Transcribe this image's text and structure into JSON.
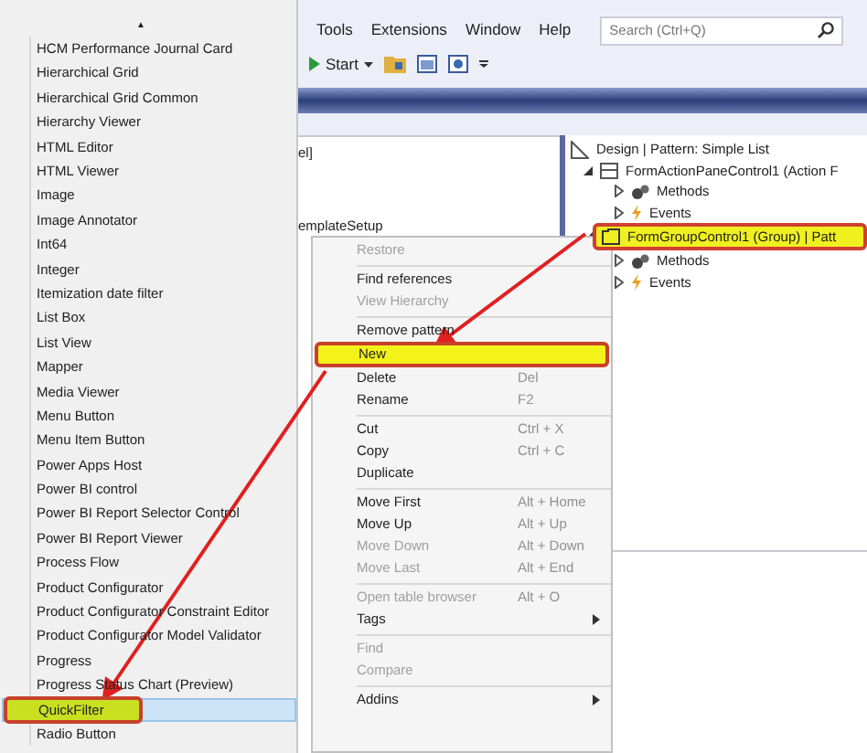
{
  "control_list": {
    "scroll_up": "▲",
    "items": [
      {
        "label": "HCM Performance Journal Card",
        "selected": false
      },
      {
        "label": "Hierarchical Grid",
        "selected": false
      },
      {
        "label": "Hierarchical Grid Common",
        "selected": false
      },
      {
        "label": "Hierarchy Viewer",
        "selected": false
      },
      {
        "label": "HTML Editor",
        "selected": false
      },
      {
        "label": "HTML Viewer",
        "selected": false
      },
      {
        "label": "Image",
        "selected": false
      },
      {
        "label": "Image Annotator",
        "selected": false
      },
      {
        "label": "Int64",
        "selected": false
      },
      {
        "label": "Integer",
        "selected": false
      },
      {
        "label": "Itemization date filter",
        "selected": false
      },
      {
        "label": "List Box",
        "selected": false
      },
      {
        "label": "List View",
        "selected": false
      },
      {
        "label": "Mapper",
        "selected": false
      },
      {
        "label": "Media Viewer",
        "selected": false
      },
      {
        "label": "Menu Button",
        "selected": false
      },
      {
        "label": "Menu Item Button",
        "selected": false
      },
      {
        "label": "Power Apps Host",
        "selected": false
      },
      {
        "label": "Power BI control",
        "selected": false
      },
      {
        "label": "Power BI Report Selector Control",
        "selected": false
      },
      {
        "label": "Power BI Report Viewer",
        "selected": false
      },
      {
        "label": "Process Flow",
        "selected": false
      },
      {
        "label": "Product Configurator",
        "selected": false
      },
      {
        "label": "Product Configurator Constraint Editor",
        "selected": false
      },
      {
        "label": "Product Configurator Model Validator",
        "selected": false
      },
      {
        "label": "Progress",
        "selected": false
      },
      {
        "label": "Progress Status Chart (Preview)",
        "selected": false
      },
      {
        "label": "QuickFilter",
        "selected": true
      },
      {
        "label": "Radio Button",
        "selected": false
      }
    ]
  },
  "menu_bar": [
    "Tools",
    "Extensions",
    "Window",
    "Help"
  ],
  "search": {
    "placeholder": "Search (Ctrl+Q)"
  },
  "toolbar": {
    "start_label": "Start"
  },
  "editor": {
    "fragments": [
      "el]",
      "emplateSetup"
    ]
  },
  "tree": [
    {
      "label": "Design | Pattern: Simple List",
      "highlighted": false,
      "children": [
        {
          "label": "FormActionPaneControl1 (Action F",
          "expanded": true,
          "highlighted": false,
          "children": [
            {
              "label": "Methods",
              "expanded": false,
              "highlighted": false
            },
            {
              "label": "Events",
              "expanded": false,
              "highlighted": false
            }
          ]
        },
        {
          "label": "FormGroupControl1 (Group) | Patt",
          "expanded": true,
          "highlighted": true,
          "children": [
            {
              "label": "Methods",
              "expanded": false,
              "highlighted": false
            },
            {
              "label": "Events",
              "expanded": false,
              "highlighted": false
            }
          ]
        }
      ]
    }
  ],
  "context_menu": [
    {
      "kind": "item",
      "label": "Restore",
      "disabled": true,
      "highlighted": false
    },
    {
      "kind": "separator"
    },
    {
      "kind": "item",
      "label": "Find references",
      "disabled": false,
      "highlighted": false
    },
    {
      "kind": "item",
      "label": "View Hierarchy",
      "disabled": true,
      "highlighted": false
    },
    {
      "kind": "separator"
    },
    {
      "kind": "item",
      "label": "Remove pattern",
      "disabled": false,
      "highlighted": false
    },
    {
      "kind": "item",
      "label": "New",
      "disabled": false,
      "highlighted": true
    },
    {
      "kind": "item",
      "label": "Delete",
      "shortcut": "Del",
      "disabled": false,
      "highlighted": false
    },
    {
      "kind": "item",
      "label": "Rename",
      "shortcut": "F2",
      "disabled": false,
      "highlighted": false
    },
    {
      "kind": "separator"
    },
    {
      "kind": "item",
      "label": "Cut",
      "shortcut": "Ctrl + X",
      "disabled": false,
      "highlighted": false
    },
    {
      "kind": "item",
      "label": "Copy",
      "shortcut": "Ctrl + C",
      "disabled": false,
      "highlighted": false
    },
    {
      "kind": "item",
      "label": "Duplicate",
      "disabled": false,
      "highlighted": false
    },
    {
      "kind": "separator"
    },
    {
      "kind": "item",
      "label": "Move First",
      "shortcut": "Alt + Home",
      "disabled": false,
      "highlighted": false
    },
    {
      "kind": "item",
      "label": "Move Up",
      "shortcut": "Alt + Up",
      "disabled": false,
      "highlighted": false
    },
    {
      "kind": "item",
      "label": "Move Down",
      "shortcut": "Alt + Down",
      "disabled": true,
      "highlighted": false
    },
    {
      "kind": "item",
      "label": "Move Last",
      "shortcut": "Alt + End",
      "disabled": true,
      "highlighted": false
    },
    {
      "kind": "separator"
    },
    {
      "kind": "item",
      "label": "Open table browser",
      "shortcut": "Alt + O",
      "disabled": true,
      "highlighted": false
    },
    {
      "kind": "item",
      "label": "Tags",
      "submenu": true,
      "disabled": false,
      "highlighted": false
    },
    {
      "kind": "separator"
    },
    {
      "kind": "item",
      "label": "Find",
      "disabled": true,
      "highlighted": false
    },
    {
      "kind": "item",
      "label": "Compare",
      "disabled": true,
      "highlighted": false
    },
    {
      "kind": "separator"
    },
    {
      "kind": "item",
      "label": "Addins",
      "submenu": true,
      "disabled": false,
      "highlighted": false
    }
  ]
}
